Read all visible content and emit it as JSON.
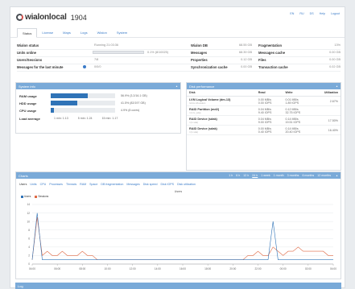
{
  "header": {
    "brand": "wialonlocal",
    "version": "1904",
    "links": [
      "EN",
      "RU",
      "DS",
      "Help",
      "Logout"
    ]
  },
  "tabs": [
    {
      "label": "Status",
      "active": true
    },
    {
      "label": "License",
      "active": false
    },
    {
      "label": "Maps",
      "active": false
    },
    {
      "label": "Logs",
      "active": false
    },
    {
      "label": "Wialon",
      "active": false
    },
    {
      "label": "System",
      "active": false
    }
  ],
  "stats": {
    "left": [
      {
        "label": "Wialon status",
        "value": "Running 21:03:36"
      },
      {
        "label": "Units online",
        "value": "0.1% (8/10025)",
        "progress": 0.1
      },
      {
        "label": "Users/Sessions",
        "value": "7/8"
      },
      {
        "label": "Messages for the last minute",
        "value": "0/0/0"
      }
    ],
    "mid": [
      {
        "label": "Wialon DB",
        "value": "68.55 GB"
      },
      {
        "label": "Messages",
        "value": "68.39 GB"
      },
      {
        "label": "Properties",
        "value": "0.12 GB"
      },
      {
        "label": "Synchronization cache",
        "value": "0.00 GB"
      }
    ],
    "right": [
      {
        "label": "Fragmentation",
        "value": "13%"
      },
      {
        "label": "Messages cache",
        "value": "0.00 GB"
      },
      {
        "label": "Files",
        "value": "0.00 GB"
      },
      {
        "label": "Transaction cache",
        "value": "0.02 GB"
      }
    ]
  },
  "system_info": {
    "title": "System info",
    "rows": [
      {
        "label": "RAM usage",
        "value": "56.9% (3.2/16.1 GB)",
        "percent": 56.9
      },
      {
        "label": "HDD usage",
        "value": "41.5% (82/197 GB)",
        "percent": 41.5
      },
      {
        "label": "CPU usage",
        "value": "4.9% (8 cores)",
        "percent": 4.9
      }
    ],
    "load_label": "Load average",
    "load": [
      "1 min: 1.13",
      "5 min: 1.24",
      "15 min: 1.17"
    ]
  },
  "disk": {
    "title": "Disk performance",
    "headers": [
      "Disk",
      "Read",
      "Write",
      "Utilization"
    ],
    "rows": [
      {
        "name": "LVM Logical Volume (dm-13)",
        "sub": "rwh-lv-db-wialon",
        "read1": "0.00 MB/s",
        "read2": "0.00 IOPS",
        "write1": "0.01 MB/s",
        "write2": "1.89 IOPS",
        "util": "2.67%"
      },
      {
        "name": "RAID Partition (md2)",
        "sub": "/ (in lv_sda)",
        "read1": "0.04 MB/s",
        "read2": "9.40 IOPS",
        "write1": "0.12 MB/s",
        "write2": "32.75 IOPS",
        "util": ""
      },
      {
        "name": "RAID Device (sdak)",
        "sub": "/ (in sda)",
        "read1": "0.04 MB/s",
        "read2": "9.00 IOPS",
        "write1": "0.14 MB/s",
        "write2": "19.51 IOPS",
        "util": "17.50%"
      },
      {
        "name": "RAID Device (sdak)",
        "sub": "/ (in sda)",
        "read1": "0.00 MB/s",
        "read2": "0.40 IOPS",
        "write1": "0.14 MB/s",
        "write2": "20.40 IOPS",
        "util": "16.40%"
      }
    ]
  },
  "charts": {
    "title": "Charts",
    "ranges": [
      "1 h",
      "6 h",
      "12 h",
      "24 h",
      "1 week",
      "1 month",
      "3 months",
      "6 months",
      "12 months"
    ],
    "selected_range": "24 h",
    "tabs": [
      "Users",
      "Units",
      "CPU",
      "Processes",
      "Threads",
      "RAM",
      "Space",
      "DB fragmentation",
      "Messages",
      "Disk speed",
      "Disk IOPS",
      "Disk utilization"
    ],
    "active_tab": "Users",
    "colors": {
      "users": "#2f73b7",
      "sessions": "#e06a45",
      "header": "#7aaad8"
    }
  },
  "chart_data": {
    "type": "line",
    "title": "Users",
    "x": [
      "04:00",
      "06:00",
      "08:00",
      "10:00",
      "12:00",
      "14:00",
      "16:00",
      "18:00",
      "20:00",
      "22:00",
      "00:00",
      "02:00",
      "04:00"
    ],
    "xticks": [
      "04:00",
      "06:00",
      "08:00",
      "10:00",
      "12:00",
      "14:00",
      "16:00",
      "18:00",
      "20:00",
      "22:00",
      "00:00",
      "02:00",
      "04:00"
    ],
    "yticks": [
      0,
      2,
      4,
      6,
      8,
      10,
      12,
      14
    ],
    "ylim": [
      0,
      14
    ],
    "grid": true,
    "legend": "top-left",
    "series": [
      {
        "name": "Users",
        "color": "#2f73b7",
        "values": [
          1,
          12,
          1,
          1,
          1,
          1,
          1,
          1,
          1,
          1,
          1,
          1,
          1,
          1,
          1,
          1,
          1,
          1,
          1,
          1,
          1,
          1,
          1,
          1,
          1,
          1,
          1,
          1,
          1,
          1,
          1,
          1,
          1,
          1,
          1,
          1,
          1,
          1,
          1,
          1,
          1,
          1,
          1,
          1,
          1,
          1,
          1,
          1,
          10,
          1,
          1,
          1,
          1,
          1,
          1,
          1,
          1,
          1,
          1,
          1,
          1
        ]
      },
      {
        "name": "Sessions",
        "color": "#e06a45",
        "values": [
          1,
          11,
          2,
          3,
          2,
          2,
          3,
          2,
          2,
          2,
          3,
          2,
          2,
          1,
          1,
          1,
          1,
          1,
          1,
          1,
          1,
          1,
          1,
          1,
          1,
          1,
          1,
          1,
          1,
          1,
          1,
          1,
          1,
          1,
          1,
          1,
          1,
          1,
          1,
          1,
          1,
          1,
          1,
          2,
          2,
          3,
          2,
          2,
          4,
          3,
          2,
          3,
          3,
          4,
          3,
          3,
          3,
          3,
          3,
          2,
          2
        ]
      }
    ]
  },
  "log": {
    "title": "Log"
  }
}
